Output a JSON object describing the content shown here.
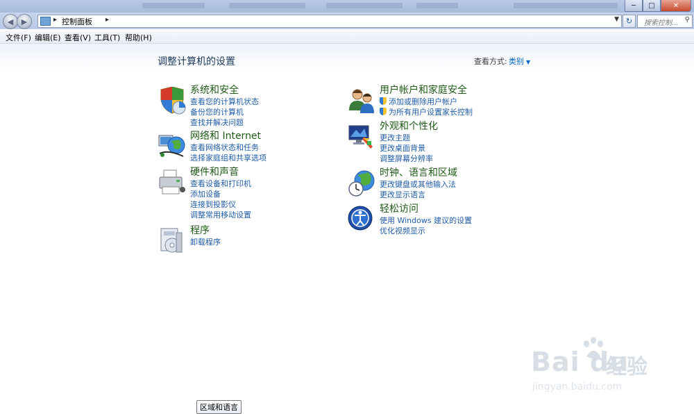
{
  "window": {
    "buttons": {
      "minimize": "─",
      "maximize": "□",
      "close": "✕"
    }
  },
  "nav": {
    "back": "◀",
    "forward": "▶",
    "address_crumb": "控制面板",
    "refresh": "↻",
    "search_placeholder": "搜索控制...",
    "search_icon": "search-icon"
  },
  "menu": [
    "文件(F)",
    "编辑(E)",
    "查看(V)",
    "工具(T)",
    "帮助(H)"
  ],
  "page": {
    "title": "调整计算机的设置",
    "view_by_label": "查看方式:",
    "view_by_value": "类别"
  },
  "categories": [
    {
      "title": "系统和安全",
      "icon": "shield-icon",
      "links": [
        "查看您的计算机状态",
        "备份您的计算机",
        "查找并解决问题"
      ]
    },
    {
      "title": "网络和 Internet",
      "icon": "network-icon",
      "links": [
        "查看网络状态和任务",
        "选择家庭组和共享选项"
      ]
    },
    {
      "title": "硬件和声音",
      "icon": "printer-icon",
      "links": [
        "查看设备和打印机",
        "添加设备",
        "连接到投影仪",
        "调整常用移动设置"
      ]
    },
    {
      "title": "程序",
      "icon": "programs-icon",
      "links": [
        "卸载程序"
      ]
    },
    {
      "title": "用户帐户和家庭安全",
      "icon": "users-icon",
      "links": [
        "添加或删除用户帐户",
        "为所有用户设置家长控制"
      ]
    },
    {
      "title": "外观和个性化",
      "icon": "appearance-icon",
      "links": [
        "更改主题",
        "更改桌面背景",
        "调整屏幕分辨率"
      ]
    },
    {
      "title": "时钟、语言和区域",
      "icon": "globe-clock-icon",
      "links": [
        "更改键盘或其他输入法",
        "更改显示语言"
      ]
    },
    {
      "title": "轻松访问",
      "icon": "accessibility-icon",
      "links": [
        "使用 Windows 建议的设置",
        "优化视频显示"
      ]
    }
  ],
  "tooltip": "区域和语言",
  "watermark": {
    "brand": "Bai du",
    "brand_cn": "经验",
    "url": "jingyan.baidu.com"
  },
  "colors": {
    "category_title": "#1e5a16",
    "link": "#1f5ca8",
    "accent": "#0066cc"
  }
}
